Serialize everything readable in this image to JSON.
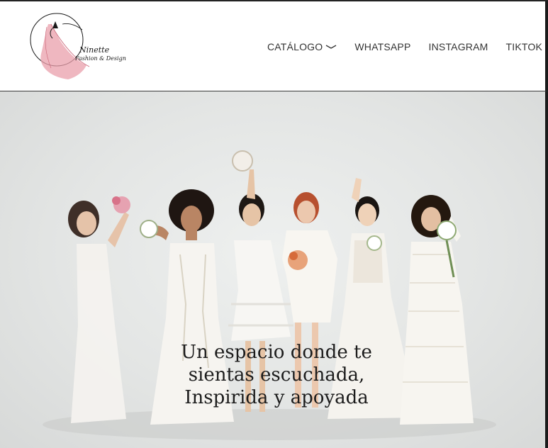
{
  "brand": {
    "logo_name": "Ninette",
    "logo_tagline": "Fashion & Design"
  },
  "nav": {
    "items": [
      {
        "label": "CATÁLOGO",
        "has_dropdown": true
      },
      {
        "label": "WHATSAPP",
        "has_dropdown": false
      },
      {
        "label": "INSTAGRAM",
        "has_dropdown": false
      },
      {
        "label": "TIKTOK",
        "has_dropdown": false
      }
    ]
  },
  "hero": {
    "headline_lines": [
      "Un espacio donde te",
      "sientas escuchada,",
      "Inspirida y apoyada"
    ]
  },
  "colors": {
    "nav_text": "#333333",
    "logo_accent": "#e89aa6",
    "hero_background": "#e3e5e4",
    "headline_text": "#1c1c1c"
  }
}
